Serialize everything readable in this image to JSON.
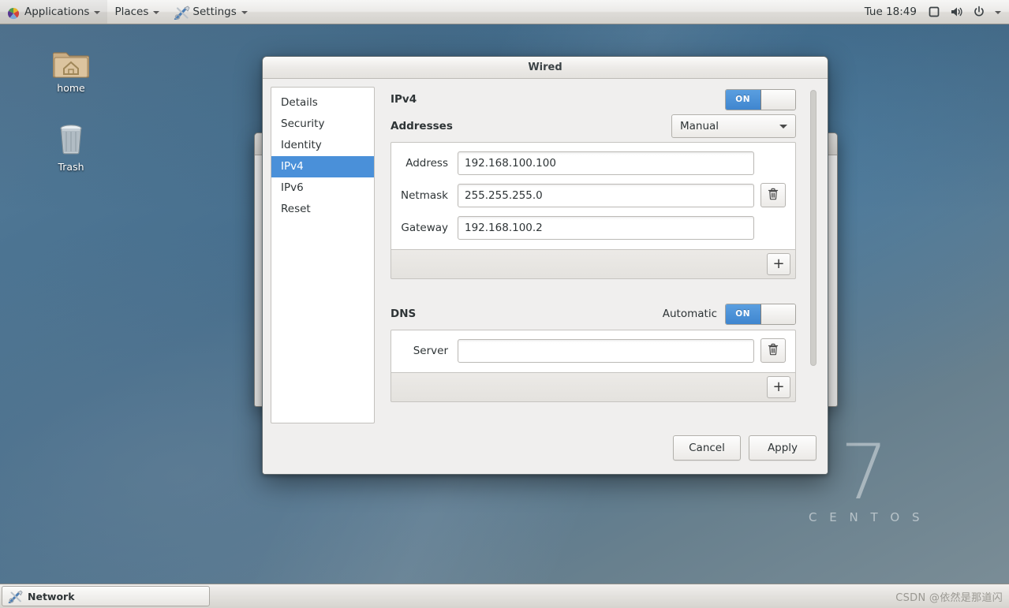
{
  "top_panel": {
    "applications": {
      "label": "Applications",
      "icon": "pinwheel-icon"
    },
    "places": {
      "label": "Places"
    },
    "settings": {
      "label": "Settings",
      "icon": "tools-icon"
    },
    "clock": "Tue 18:49",
    "tray": [
      {
        "name": "display-icon",
        "glyph": "display"
      },
      {
        "name": "volume-icon",
        "glyph": "speaker"
      },
      {
        "name": "power-icon",
        "glyph": "power"
      },
      {
        "name": "chevron-down-icon",
        "glyph": "caret"
      }
    ]
  },
  "desktop": {
    "icons": [
      {
        "label": "home",
        "icon": "home-folder-icon"
      },
      {
        "label": "Trash",
        "icon": "trash-icon"
      }
    ],
    "branding": {
      "version": "7",
      "name": "C E N T O S"
    }
  },
  "dialog": {
    "title": "Wired",
    "sidebar": {
      "items": [
        {
          "label": "Details",
          "selected": false
        },
        {
          "label": "Security",
          "selected": false
        },
        {
          "label": "Identity",
          "selected": false
        },
        {
          "label": "IPv4",
          "selected": true
        },
        {
          "label": "IPv6",
          "selected": false
        },
        {
          "label": "Reset",
          "selected": false
        }
      ]
    },
    "ipv4": {
      "section_label": "IPv4",
      "enabled_switch": {
        "state": "ON",
        "label": "ON"
      },
      "addresses_label": "Addresses",
      "method": {
        "selected": "Manual"
      },
      "fields": [
        {
          "label": "Address",
          "value": "192.168.100.100",
          "placeholder": ""
        },
        {
          "label": "Netmask",
          "value": "255.255.255.0",
          "placeholder": ""
        },
        {
          "label": "Gateway",
          "value": "192.168.100.2",
          "placeholder": ""
        }
      ],
      "delete_icon": "trash-icon",
      "add_label": "+"
    },
    "dns": {
      "section_label": "DNS",
      "automatic_label": "Automatic",
      "automatic_switch": {
        "state": "ON",
        "label": "ON"
      },
      "fields": [
        {
          "label": "Server",
          "value": "",
          "placeholder": ""
        }
      ],
      "delete_icon": "trash-icon",
      "add_label": "+"
    },
    "actions": {
      "cancel_label": "Cancel",
      "apply_label": "Apply"
    }
  },
  "bottom_panel": {
    "task": {
      "label": "Network",
      "icon": "tools-icon"
    },
    "watermark": "CSDN @依然是那道闪"
  },
  "colors": {
    "accent": "#4a90d9",
    "switch_on": "#3f86cf",
    "panel_bg": "#e3e1dd",
    "dialog_bg": "#f0efee"
  }
}
